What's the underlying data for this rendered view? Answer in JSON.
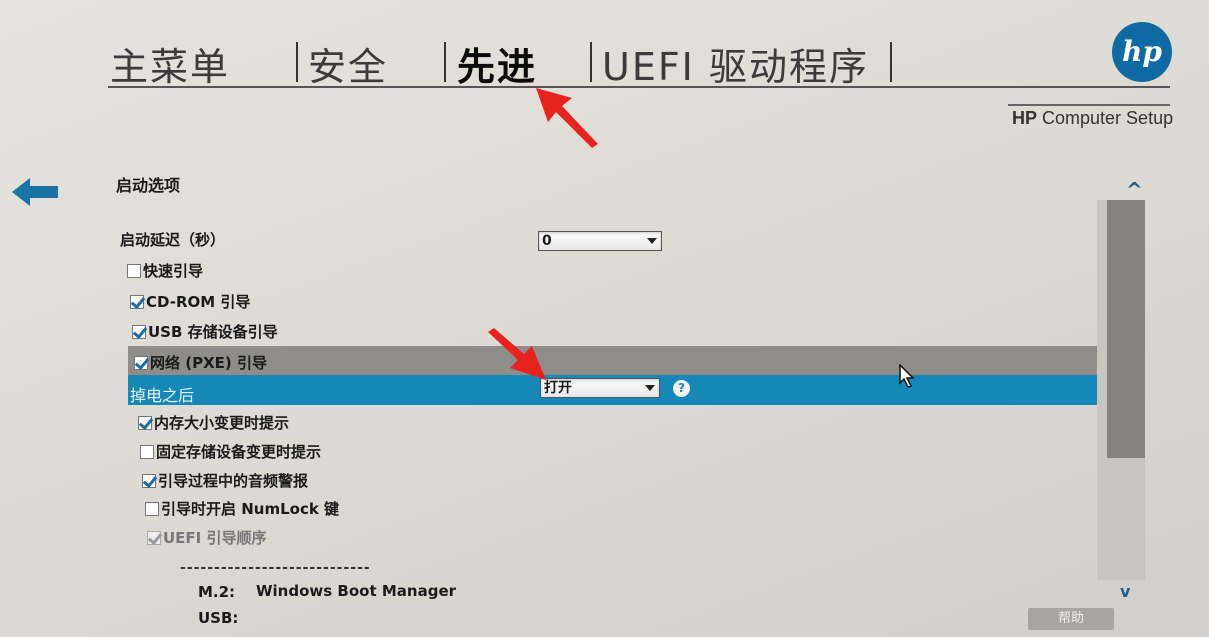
{
  "tabs": [
    {
      "label": "主菜单",
      "active": false
    },
    {
      "label": "安全",
      "active": false
    },
    {
      "label": "先进",
      "active": true
    },
    {
      "label": "UEFI 驱动程序",
      "active": false
    }
  ],
  "brand": {
    "logo_text": "hp",
    "title_bold": "HP",
    "title_rest": " Computer Setup",
    "accent": "#0d6aa3"
  },
  "section_title": "启动选项",
  "boot_delay": {
    "label": "启动延迟（秒）",
    "value": "0"
  },
  "options": [
    {
      "label": "快速引导",
      "checked": false
    },
    {
      "label": "CD-ROM 引导",
      "checked": true
    },
    {
      "label": "USB 存储设备引导",
      "checked": true
    },
    {
      "label": "网络 (PXE) 引导",
      "checked": true
    }
  ],
  "power_loss": {
    "label": "掉电之后",
    "value": "打开",
    "help": "?",
    "highlight": "#1688b8"
  },
  "options2": [
    {
      "label": "内存大小变更时提示",
      "checked": true
    },
    {
      "label": "固定存储设备变更时提示",
      "checked": false
    },
    {
      "label": "引导过程中的音频警报",
      "checked": true
    },
    {
      "label": "引导时开启 NumLock 键",
      "checked": false
    },
    {
      "label": "UEFI 引导顺序",
      "checked": true,
      "disabled": true
    }
  ],
  "boot_order": {
    "separator": "----------------------------",
    "entries": [
      {
        "key": "M.2:",
        "value": "Windows Boot Manager"
      },
      {
        "key": "USB:",
        "value": ""
      }
    ]
  },
  "scroll": {
    "up": "^",
    "down": "v"
  },
  "help_button": "帮助"
}
